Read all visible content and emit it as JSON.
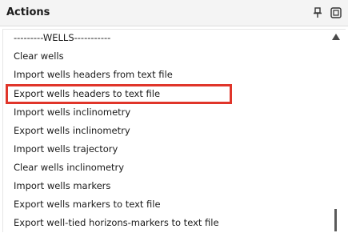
{
  "panel": {
    "title": "Actions"
  },
  "header_icons": {
    "pin": "pin-icon",
    "float": "float-window-icon"
  },
  "list": {
    "items": [
      "---------WELLS-----------",
      "Clear wells",
      "Import wells headers from text file",
      "Export wells headers to text file",
      "Import wells inclinometry",
      "Export wells inclinometry",
      "Import wells trajectory",
      "Clear wells inclinometry",
      "Import wells markers",
      "Export wells markers to text file",
      "Export well-tied horizons-markers to text file"
    ],
    "highlighted_item": "Export wells headers to text file"
  },
  "colors": {
    "highlight": "#e0352a",
    "header_bg": "#f4f4f4"
  }
}
